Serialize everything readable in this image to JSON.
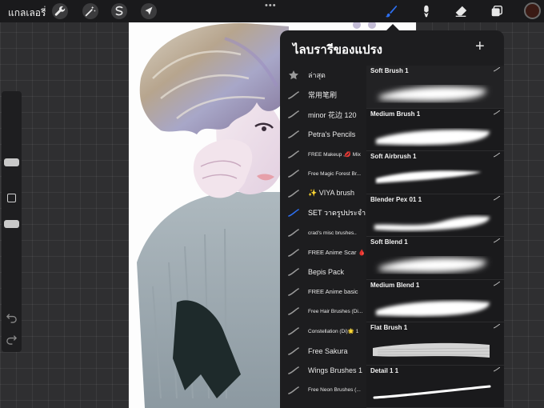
{
  "toolbar": {
    "gallery_label": "แกลเลอรี่",
    "more_label": "•••",
    "tools": [
      {
        "name": "wrench-icon"
      },
      {
        "name": "magic-wand-icon"
      },
      {
        "name": "selection-icon"
      },
      {
        "name": "transform-arrow-icon"
      },
      {
        "name": "brush-icon",
        "active": true
      },
      {
        "name": "smudge-icon"
      },
      {
        "name": "eraser-icon"
      },
      {
        "name": "layers-icon"
      }
    ],
    "current_color": "#3a1a14",
    "accent_color": "#2d6ff0"
  },
  "brush_library": {
    "title": "ไลบรารีของแปรง",
    "add_label": "+",
    "sets": [
      {
        "label": "ล่าสุด",
        "icon": "star-icon"
      },
      {
        "label": "常用笔刷",
        "icon": "brush-stroke-icon"
      },
      {
        "label": "minor 花边 120",
        "icon": "brush-stroke-icon"
      },
      {
        "label": "Petra's Pencils",
        "icon": "brush-stroke-icon"
      },
      {
        "label": "FREE Makeup ,💋 Mix",
        "icon": "brush-stroke-icon"
      },
      {
        "label": "Free Magic Forest Br...",
        "icon": "brush-stroke-icon"
      },
      {
        "label": "✨ VIYA brush",
        "icon": "brush-stroke-icon"
      },
      {
        "label": "SET วาดรูปประจำ",
        "icon": "brush-stroke-icon",
        "active": true
      },
      {
        "label": "crad's misc brushes..",
        "icon": "brush-stroke-icon"
      },
      {
        "label": "FREE Anime Scar 🩸",
        "icon": "brush-stroke-icon"
      },
      {
        "label": "Bepis Pack",
        "icon": "brush-stroke-icon"
      },
      {
        "label": "FREE Anime basic",
        "icon": "brush-stroke-icon"
      },
      {
        "label": "Free Hair Brushes (Di...",
        "icon": "brush-stroke-icon"
      },
      {
        "label": "Constellation (Di)🌟 1",
        "icon": "brush-stroke-icon"
      },
      {
        "label": "Free Sakura",
        "icon": "brush-stroke-icon"
      },
      {
        "label": "Wings Brushes 1",
        "icon": "brush-stroke-icon"
      },
      {
        "label": "Free Neon Brushes (...",
        "icon": "brush-stroke-icon"
      }
    ],
    "brushes": [
      {
        "name": "Soft Brush 1",
        "stroke": "soft"
      },
      {
        "name": "Medium Brush 1",
        "stroke": "medium"
      },
      {
        "name": "Soft Airbrush 1",
        "stroke": "thin-wave"
      },
      {
        "name": "Blender Pex 01 1",
        "stroke": "wave"
      },
      {
        "name": "Soft Blend 1",
        "stroke": "soft"
      },
      {
        "name": "Medium Blend 1",
        "stroke": "medium"
      },
      {
        "name": "Flat Brush 1",
        "stroke": "flat"
      },
      {
        "name": "Detail 1 1",
        "stroke": "thin-line"
      }
    ]
  }
}
